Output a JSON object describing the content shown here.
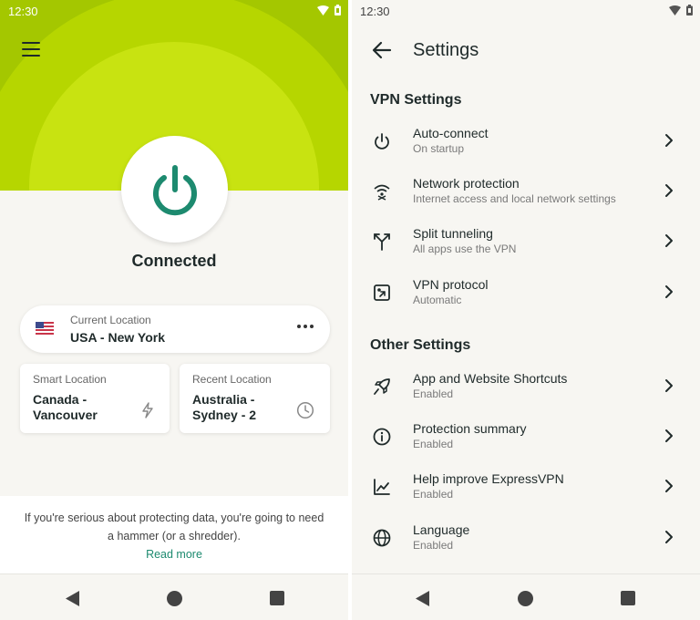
{
  "status_bar": {
    "time": "12:30"
  },
  "home": {
    "status": "Connected",
    "current_location": {
      "label": "Current Location",
      "value": "USA - New York"
    },
    "smart_location": {
      "label": "Smart Location",
      "value": "Canada -\nVancouver"
    },
    "recent_location": {
      "label": "Recent Location",
      "value": "Australia -\nSydney - 2"
    },
    "tip": {
      "text": "If you're serious about protecting data, you're going to need a hammer (or a shredder).",
      "link": "Read more"
    }
  },
  "settings": {
    "title": "Settings",
    "sections": [
      {
        "title": "VPN Settings",
        "items": [
          {
            "icon": "power-icon",
            "label": "Auto-connect",
            "sub": "On startup"
          },
          {
            "icon": "network-protection-icon",
            "label": "Network protection",
            "sub": "Internet access and local network settings"
          },
          {
            "icon": "split-tunneling-icon",
            "label": "Split tunneling",
            "sub": "All apps use the VPN"
          },
          {
            "icon": "vpn-protocol-icon",
            "label": "VPN protocol",
            "sub": "Automatic"
          }
        ]
      },
      {
        "title": "Other Settings",
        "items": [
          {
            "icon": "rocket-icon",
            "label": "App and Website Shortcuts",
            "sub": "Enabled"
          },
          {
            "icon": "info-icon",
            "label": "Protection summary",
            "sub": "Enabled"
          },
          {
            "icon": "chart-icon",
            "label": "Help improve ExpressVPN",
            "sub": "Enabled"
          },
          {
            "icon": "globe-icon",
            "label": "Language",
            "sub": "Enabled"
          }
        ]
      }
    ]
  },
  "colors": {
    "accent_green": "#1d8a6f",
    "hero_lime": "#c8e311",
    "background": "#f7f6f2"
  }
}
